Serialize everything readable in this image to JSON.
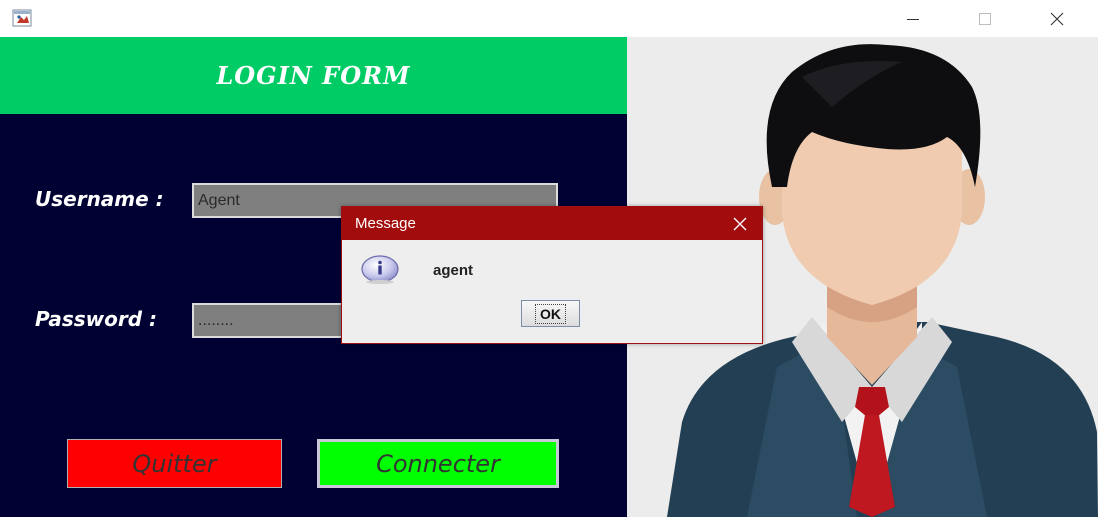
{
  "window": {
    "icons": {
      "app": "java-coffee-icon",
      "minimize": "minimize-icon",
      "maximize": "maximize-icon",
      "close": "close-icon"
    }
  },
  "form": {
    "title": "LOGIN FORM",
    "username_label": "Username :",
    "username_value": "Agent",
    "password_label": "Password :",
    "password_value": "........",
    "quit_label": "Quitter",
    "connect_label": "Connecter"
  },
  "dialog": {
    "title": "Message",
    "message": "agent",
    "ok_label": "OK",
    "icon": "info-icon"
  },
  "colors": {
    "form_header": "#00cc66",
    "form_bg": "#000033",
    "quit_button": "#ff0000",
    "connect_button": "#00ff00",
    "dialog_title": "#a30c0c"
  }
}
